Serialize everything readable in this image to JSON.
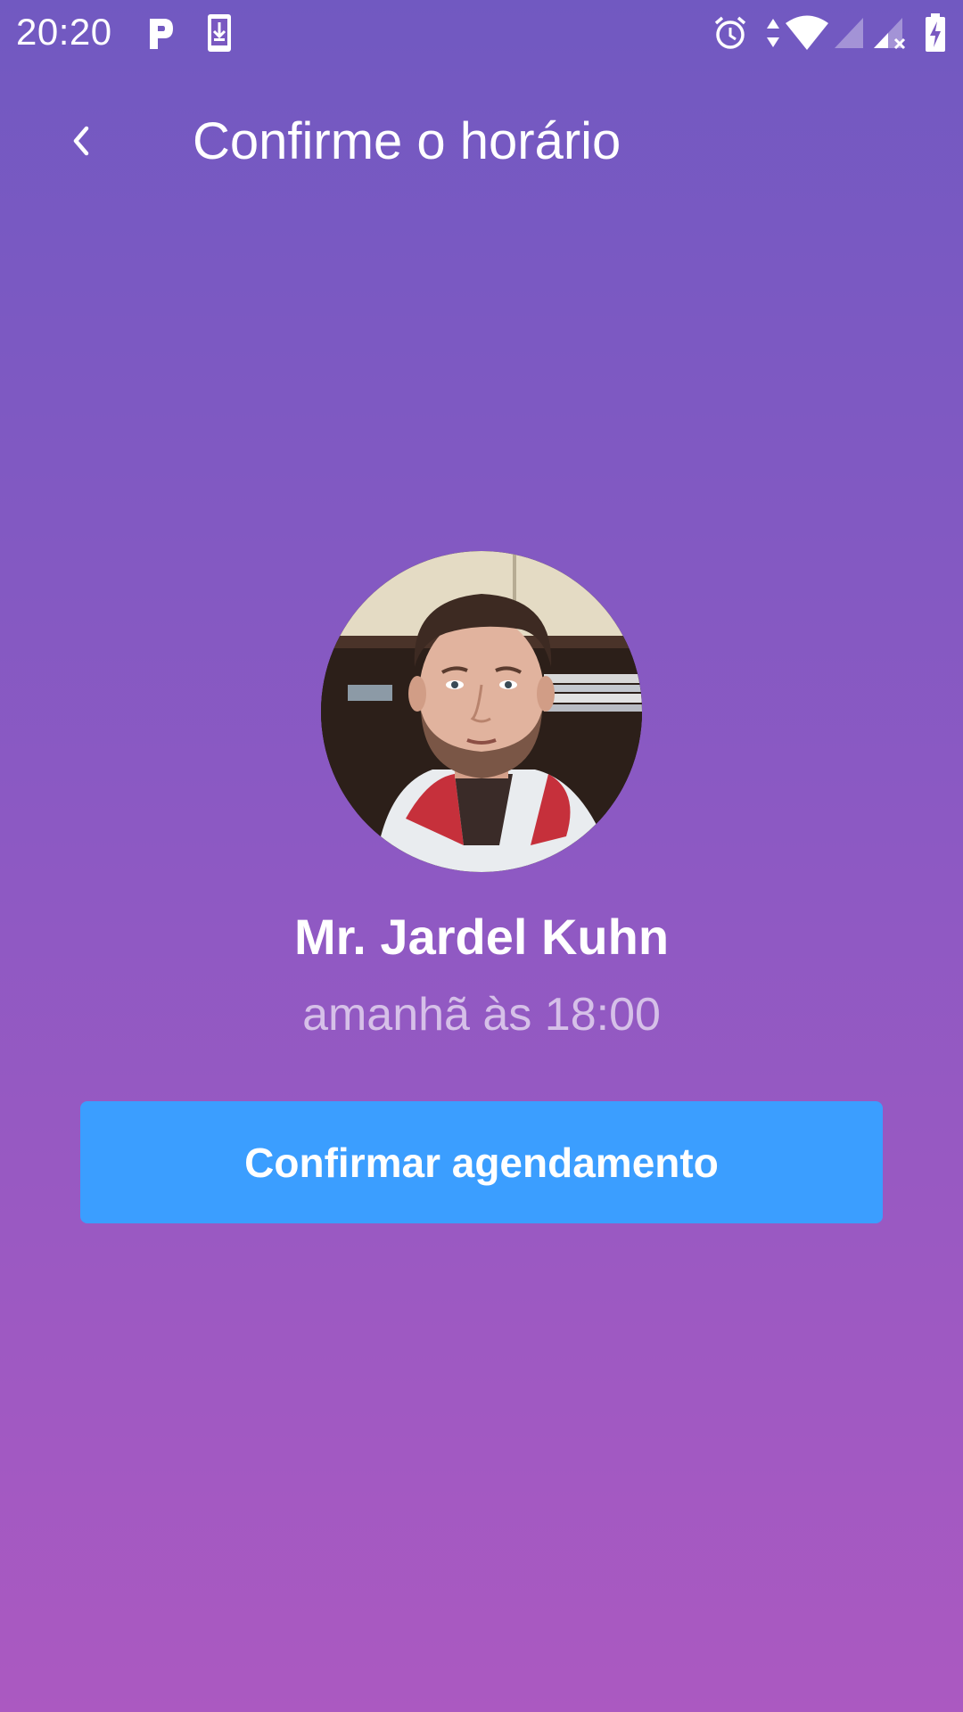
{
  "status_bar": {
    "time": "20:20",
    "icons": [
      "parking-app-icon",
      "download-icon",
      "alarm-icon",
      "data-arrows-icon",
      "wifi-icon",
      "signal-icon",
      "signal-no-service-icon",
      "battery-charging-icon"
    ]
  },
  "header": {
    "back_icon": "chevron-left-icon",
    "title": "Confirme o horário"
  },
  "provider": {
    "avatar": "avatar-photo",
    "name": "Mr. Jardel Kuhn",
    "schedule": "amanhã às 18:00"
  },
  "actions": {
    "confirm_label": "Confirmar agendamento"
  },
  "colors": {
    "gradient_top": "#7159c1",
    "gradient_bottom": "#ab59c1",
    "button": "#3b9eff",
    "text": "#ffffff"
  }
}
